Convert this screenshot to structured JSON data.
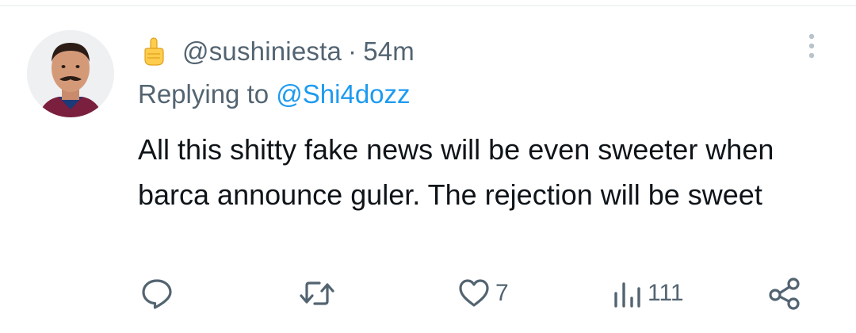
{
  "tweet": {
    "emoji": "☝",
    "handle": "@sushiniesta",
    "separator": "·",
    "time": "54m",
    "replying_prefix": "Replying to ",
    "replying_to": "@Shi4dozz",
    "text": "All this shitty fake news will be even sweeter when barca announce guler. The rejection will be sweet"
  },
  "actions": {
    "reply_icon": "reply-bubble-icon",
    "retweet_icon": "retweet-icon",
    "like_icon": "heart-icon",
    "like_count": "7",
    "views_icon": "views-bars-icon",
    "views_count": "111",
    "share_icon": "share-icon"
  },
  "colors": {
    "text": "#0f1419",
    "secondary": "#536471",
    "link": "#1d9bf0",
    "divider": "#eff3f4"
  }
}
